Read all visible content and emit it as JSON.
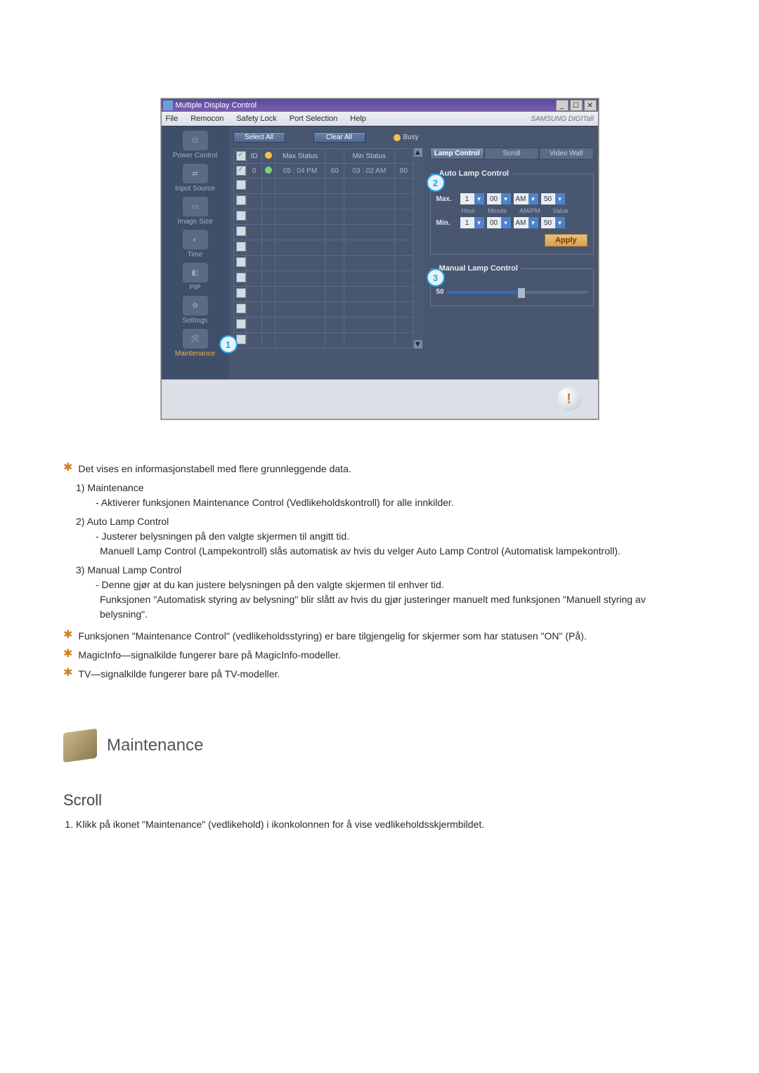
{
  "app": {
    "title": "Multiple Display Control",
    "brand": "SAMSUNG DIGITall"
  },
  "menu": [
    "File",
    "Remocon",
    "Safety Lock",
    "Port Selection",
    "Help"
  ],
  "sidebar": [
    {
      "label": "Power Control"
    },
    {
      "label": "Input Source"
    },
    {
      "label": "Image Size"
    },
    {
      "label": "Time"
    },
    {
      "label": "PIP"
    },
    {
      "label": "Settings"
    },
    {
      "label": "Maintenance",
      "active": true
    }
  ],
  "toolbar": {
    "select_all": "Select All",
    "clear_all": "Clear All",
    "busy": "Busy"
  },
  "grid": {
    "headers": [
      "",
      "ID",
      "",
      "Max Status",
      "",
      "Min Status",
      ""
    ],
    "row0": {
      "checked": true,
      "id": "0",
      "max_status": "05 : 04 PM",
      "max_val": "60",
      "min_status": "03 : 02 AM",
      "min_val": "80"
    }
  },
  "tabs": {
    "lamp": "Lamp Control",
    "scroll": "Scroll",
    "videowall": "Video Wall"
  },
  "auto_lamp": {
    "legend": "Auto Lamp Control",
    "max_label": "Max.",
    "min_label": "Min.",
    "sub_labels": [
      "Hour",
      "Minute",
      "AM/PM",
      "Value"
    ],
    "max": {
      "hour": "1",
      "minute": "00",
      "ampm": "AM",
      "value": "50"
    },
    "min": {
      "hour": "1",
      "minute": "00",
      "ampm": "AM",
      "value": "50"
    },
    "apply": "Apply"
  },
  "manual_lamp": {
    "legend": "Manual Lamp Control",
    "value": "50"
  },
  "badges": {
    "b1": "1",
    "b2": "2",
    "b3": "3"
  },
  "doc": {
    "star1": "Det vises en informasjonstabell med flere grunnleggende data.",
    "n1_title": "1)  Maintenance",
    "n1_body": "- Aktiverer funksjonen Maintenance Control (Vedlikeholdskontroll) for alle innkilder.",
    "n2_title": "2)  Auto Lamp Control",
    "n2_body1": "- Justerer belysningen på den valgte skjermen til angitt tid.",
    "n2_body2": "Manuell Lamp Control (Lampekontroll) slås automatisk av hvis du velger Auto Lamp Control (Automatisk lampekontroll).",
    "n3_title": "3)  Manual Lamp Control",
    "n3_body1": "- Denne gjør at du kan justere belysningen på den valgte skjermen til enhver tid.",
    "n3_body2": "Funksjonen \"Automatisk styring av belysning\" blir slått av hvis du gjør justeringer manuelt med funksjonen \"Manuell styring av belysning\".",
    "star2": "Funksjonen \"Maintenance Control\" (vedlikeholdsstyring) er bare tilgjengelig for skjermer som har statusen \"ON\" (På).",
    "star3": "MagicInfo—signalkilde fungerer bare på MagicInfo-modeller.",
    "star4": "TV—signalkilde fungerer bare på TV-modeller.",
    "section_title": "Maintenance",
    "scroll_title": "Scroll",
    "scroll_step1": "Klikk på ikonet \"Maintenance\" (vedlikehold) i ikonkolonnen for å vise vedlikeholdsskjermbildet."
  }
}
